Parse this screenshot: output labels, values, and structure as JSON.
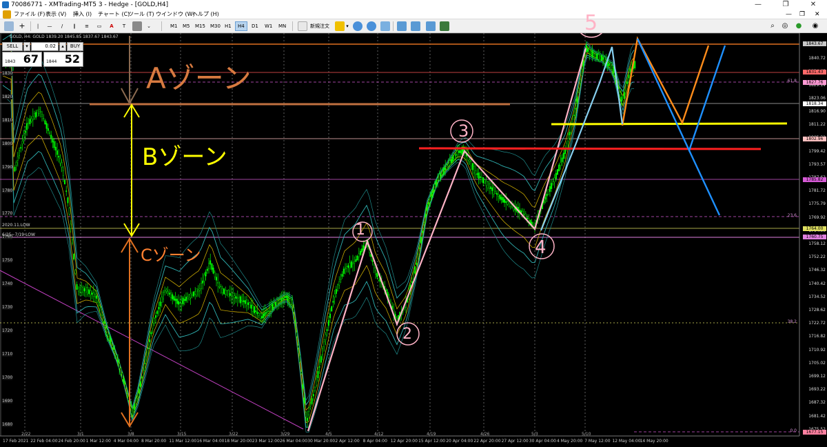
{
  "window": {
    "title": "70086771 - XMTrading-MT5 3 - Hedge - [GOLD,H4]",
    "min_btn": "—",
    "max_btn": "❐",
    "close_btn": "✕"
  },
  "menu": {
    "items": [
      "ファイル (F)",
      "表示 (V)",
      "挿入 (I)",
      "チャート (C)",
      "ツール (T)",
      "ウインドウ (W)",
      "ヘルプ (H)"
    ],
    "mdi_min": "—",
    "mdi_max": "❐",
    "mdi_close": "✕"
  },
  "toolbar": {
    "timeframes": [
      "M1",
      "M5",
      "M15",
      "M30",
      "H1",
      "H4",
      "D1",
      "W1",
      "MN"
    ],
    "active_timeframe": "H4",
    "new_order_label": "新規注文"
  },
  "chart": {
    "symbol_info": "GOLD, H4:  GOLD   1839.20  1845.85  1837.67  1843.67",
    "sell_label": "SELL",
    "buy_label": "BUY",
    "lot_value": "0.02",
    "sell_price_small": "1843",
    "sell_price_big": "67",
    "buy_price_small": "1844",
    "buy_price_big": "52",
    "price_axis": [
      "1846.53",
      "1840.72",
      "1834.68",
      "1829.14",
      "1823.06",
      "1816.90",
      "1811.22",
      "1805.32",
      "1799.42",
      "1793.57",
      "1787.62",
      "1781.72",
      "1775.79",
      "1769.92",
      "1764.00",
      "1758.12",
      "1752.22",
      "1746.32",
      "1740.42",
      "1734.52",
      "1728.62",
      "1722.72",
      "1716.82",
      "1710.92",
      "1705.02",
      "1699.12",
      "1693.22",
      "1687.32",
      "1681.42",
      "1675.52"
    ],
    "price_boxes": [
      {
        "label": "1843.67",
        "color": "#c8c8c8"
      },
      {
        "label": "1831.43",
        "color": "#ff6a6a"
      },
      {
        "label": "1827.76",
        "color": "#ff9ad5"
      },
      {
        "label": "1818.34",
        "color": "#ffffff"
      },
      {
        "label": "1802.96",
        "color": "#ffc0c0"
      },
      {
        "label": "1785.82",
        "color": "#d65ad6"
      },
      {
        "label": "1764.00",
        "color": "#e0e060"
      },
      {
        "label": "1760.75",
        "color": "#e080e0"
      },
      {
        "label": "1677.15",
        "color": "#ff80a0"
      }
    ],
    "fib_labels": [
      "61.8",
      "23.6",
      "38.2",
      "0.0"
    ],
    "left_axis": [
      "1830",
      "1820",
      "1810",
      "1800",
      "1790",
      "1780",
      "1770",
      "1760",
      "1750",
      "1740",
      "1730",
      "1720",
      "1710",
      "1700",
      "1690",
      "1680"
    ],
    "left_notes": [
      "2020.11.LOW",
      "6/25~7/19-LOW"
    ],
    "time_axis": [
      "17 Feb 2021",
      "22 Feb 04:00",
      "24 Feb 20:00",
      "1 Mar 12:00",
      "4 Mar 04:00",
      "8 Mar 20:00",
      "11 Mar 12:00",
      "16 Mar 04:00",
      "18 Mar 20:00",
      "23 Mar 12:00",
      "26 Mar 04:00",
      "30 Mar 20:00",
      "2 Apr 12:00",
      "8 Apr 04:00",
      "12 Apr 20:00",
      "15 Apr 12:00",
      "20 Apr 04:00",
      "22 Apr 20:00",
      "27 Apr 12:00",
      "30 Apr 04:00",
      "4 May 20:00",
      "7 May 12:00",
      "12 May 04:00",
      "14 May 20:00"
    ],
    "week_marks": [
      "2/22",
      "3/1",
      "3/8",
      "3/15",
      "3/22",
      "3/29",
      "4/5",
      "4/12",
      "4/19",
      "4/26",
      "5/3",
      "5/10"
    ]
  },
  "annotations": {
    "zone_a": "Aゾーン",
    "zone_b": "Bゾーン",
    "zone_c": "Cゾーン",
    "wave_labels": [
      "1",
      "2",
      "3",
      "4",
      "5"
    ]
  },
  "colors": {
    "candle": "#00ff00",
    "bollinger": "#2fb3b3",
    "ma": "#c8a800",
    "zone_arrow_a": "#e07020",
    "zone_arrow_b": "#ffff00",
    "wave": "#ffb3c6",
    "forecast_orange": "#ff8c1a",
    "forecast_blue": "#1e90ff"
  }
}
